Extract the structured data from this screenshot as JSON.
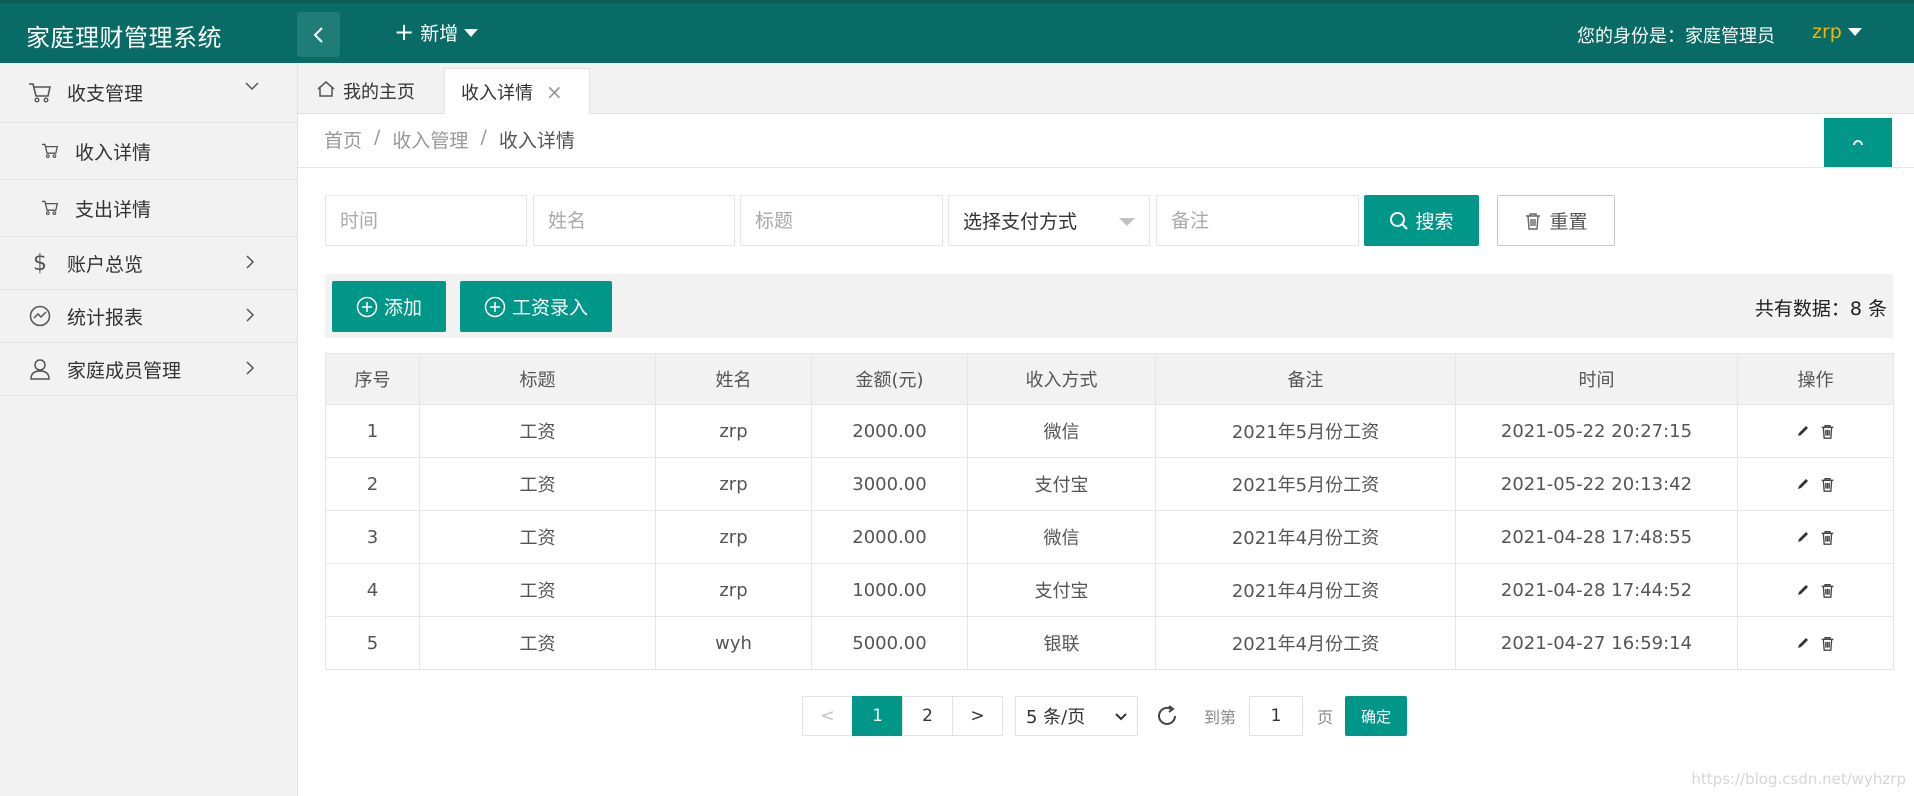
{
  "header": {
    "logo": "家庭理财管理系统",
    "new_label": "新增",
    "identity_text": "您的身份是：家庭管理员",
    "username": "zrp"
  },
  "sidebar": {
    "items": [
      {
        "label": "收支管理",
        "icon": "cart-icon"
      },
      {
        "label": "收入详情",
        "icon": "cart-icon"
      },
      {
        "label": "支出详情",
        "icon": "cart-icon"
      },
      {
        "label": "账户总览",
        "icon": "dollar-icon"
      },
      {
        "label": "统计报表",
        "icon": "chart-icon"
      },
      {
        "label": "家庭成员管理",
        "icon": "user-icon"
      }
    ]
  },
  "tabs": [
    {
      "label": "我的主页"
    },
    {
      "label": "收入详情"
    }
  ],
  "breadcrumb": {
    "items": [
      "首页",
      "收入管理",
      "收入详情"
    ],
    "separator": "/"
  },
  "search": {
    "time_placeholder": "时间",
    "name_placeholder": "姓名",
    "title_placeholder": "标题",
    "payment_select": "选择支付方式",
    "note_placeholder": "备注",
    "search_label": "搜索",
    "reset_label": "重置"
  },
  "toolbar": {
    "add_label": "添加",
    "salary_label": "工资录入",
    "total_text": "共有数据：8 条"
  },
  "table": {
    "headers": [
      "序号",
      "标题",
      "姓名",
      "金额(元)",
      "收入方式",
      "备注",
      "时间",
      "操作"
    ],
    "rows": [
      {
        "no": "1",
        "title": "工资",
        "name": "zrp",
        "amount": "2000.00",
        "method": "微信",
        "note": "2021年5月份工资",
        "time": "2021-05-22 20:27:15"
      },
      {
        "no": "2",
        "title": "工资",
        "name": "zrp",
        "amount": "3000.00",
        "method": "支付宝",
        "note": "2021年5月份工资",
        "time": "2021-05-22 20:13:42"
      },
      {
        "no": "3",
        "title": "工资",
        "name": "zrp",
        "amount": "2000.00",
        "method": "微信",
        "note": "2021年4月份工资",
        "time": "2021-04-28 17:48:55"
      },
      {
        "no": "4",
        "title": "工资",
        "name": "zrp",
        "amount": "1000.00",
        "method": "支付宝",
        "note": "2021年4月份工资",
        "time": "2021-04-28 17:44:52"
      },
      {
        "no": "5",
        "title": "工资",
        "name": "wyh",
        "amount": "5000.00",
        "method": "银联",
        "note": "2021年4月份工资",
        "time": "2021-04-27 16:59:14"
      }
    ]
  },
  "pagination": {
    "prev": "<",
    "pages": [
      "1",
      "2"
    ],
    "next": ">",
    "limit": "5 条/页",
    "goto_label": "到第",
    "goto_value": "1",
    "page_label": "页",
    "confirm": "确定"
  },
  "watermark": "https://blog.csdn.net/wyhzrp",
  "colors": {
    "header_bg": "#086b65",
    "primary": "#009688",
    "username": "#f5b400"
  }
}
